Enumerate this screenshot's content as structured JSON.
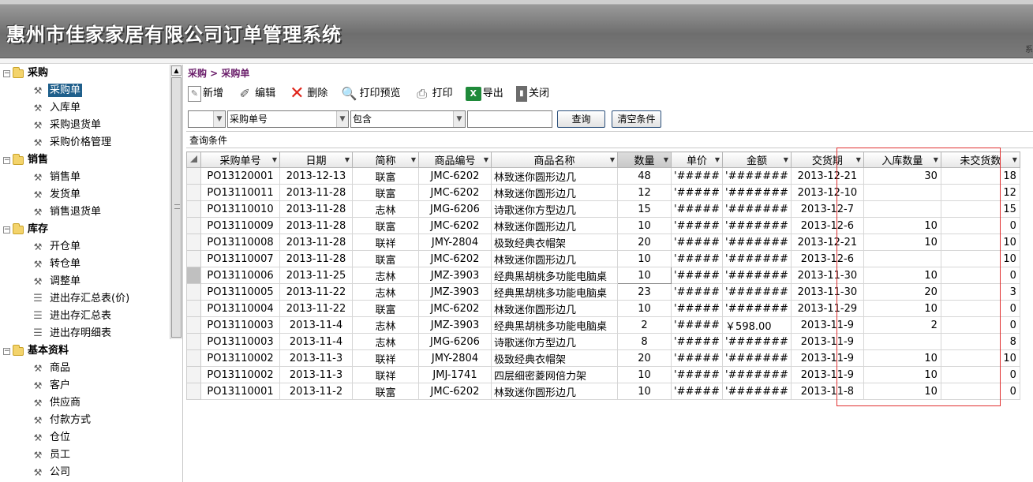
{
  "app": {
    "title": "惠州市佳家家居有限公司订单管理系统",
    "header_mark": "系"
  },
  "sidebar": {
    "groups": [
      {
        "label": "采购",
        "items": [
          "采购单",
          "入库单",
          "采购退货单",
          "采购价格管理"
        ]
      },
      {
        "label": "销售",
        "items": [
          "销售单",
          "发货单",
          "销售退货单"
        ]
      },
      {
        "label": "库存",
        "items": [
          "开仓单",
          "转仓单",
          "调整单",
          "进出存汇总表(价)",
          "进出存汇总表",
          "进出存明细表"
        ]
      },
      {
        "label": "基本资料",
        "items": [
          "商品",
          "客户",
          "供应商",
          "付款方式",
          "仓位",
          "员工",
          "公司"
        ]
      }
    ],
    "selected": "采购单"
  },
  "breadcrumb": "采购 > 采购单",
  "toolbar": {
    "new": "新增",
    "edit": "编辑",
    "delete": "删除",
    "print_preview": "打印预览",
    "print": "打印",
    "export": "导出",
    "close": "关闭"
  },
  "filter": {
    "field_value": "采购单号",
    "operator_value": "包含",
    "keyword_value": "",
    "query_button": "查询",
    "clear_button": "清空条件",
    "conditions_label": "查询条件"
  },
  "grid": {
    "columns": [
      "采购单号",
      "日期",
      "简称",
      "商品编号",
      "商品名称",
      "数量",
      "单价",
      "金额",
      "交货期",
      "入库数量",
      "未交货数"
    ],
    "sorted_column": "数量",
    "rows": [
      [
        "PO13120001",
        "2013-12-13",
        "联富",
        "JMC-6202",
        "林致迷你圆形边几",
        "48",
        "'#####",
        "'#######",
        "2013-12-21",
        "30",
        "18"
      ],
      [
        "PO13110011",
        "2013-11-28",
        "联富",
        "JMC-6202",
        "林致迷你圆形边几",
        "12",
        "'#####",
        "'#######",
        "2013-12-10",
        "",
        "12"
      ],
      [
        "PO13110010",
        "2013-11-28",
        "志林",
        "JMG-6206",
        "诗歌迷你方型边几",
        "15",
        "'#####",
        "'#######",
        "2013-12-7",
        "",
        "15"
      ],
      [
        "PO13110009",
        "2013-11-28",
        "联富",
        "JMC-6202",
        "林致迷你圆形边几",
        "10",
        "'#####",
        "'#######",
        "2013-12-6",
        "10",
        "0"
      ],
      [
        "PO13110008",
        "2013-11-28",
        "联祥",
        "JMY-2804",
        "极致经典衣帽架",
        "20",
        "'#####",
        "'#######",
        "2013-12-21",
        "10",
        "10"
      ],
      [
        "PO13110007",
        "2013-11-28",
        "联富",
        "JMC-6202",
        "林致迷你圆形边几",
        "10",
        "'#####",
        "'#######",
        "2013-12-6",
        "",
        "10"
      ],
      [
        "PO13110006",
        "2013-11-25",
        "志林",
        "JMZ-3903",
        "经典黑胡桃多功能电脑桌",
        "10",
        "'#####",
        "'#######",
        "2013-11-30",
        "10",
        "0"
      ],
      [
        "PO13110005",
        "2013-11-22",
        "志林",
        "JMZ-3903",
        "经典黑胡桃多功能电脑桌",
        "23",
        "'#####",
        "'#######",
        "2013-11-30",
        "20",
        "3"
      ],
      [
        "PO13110004",
        "2013-11-22",
        "联富",
        "JMC-6202",
        "林致迷你圆形边几",
        "10",
        "'#####",
        "'#######",
        "2013-11-29",
        "10",
        "0"
      ],
      [
        "PO13110003",
        "2013-11-4",
        "志林",
        "JMZ-3903",
        "经典黑胡桃多功能电脑桌",
        "2",
        "'#####",
        "￥598.00",
        "2013-11-9",
        "2",
        "0"
      ],
      [
        "PO13110003",
        "2013-11-4",
        "志林",
        "JMG-6206",
        "诗歌迷你方型边几",
        "8",
        "'#####",
        "'#######",
        "2013-11-9",
        "",
        "8"
      ],
      [
        "PO13110002",
        "2013-11-3",
        "联祥",
        "JMY-2804",
        "极致经典衣帽架",
        "20",
        "'#####",
        "'#######",
        "2013-11-9",
        "10",
        "10"
      ],
      [
        "PO13110002",
        "2013-11-3",
        "联祥",
        "JMJ-1741",
        "四层细密菱网倍力架",
        "10",
        "'#####",
        "'#######",
        "2013-11-9",
        "10",
        "0"
      ],
      [
        "PO13110001",
        "2013-11-2",
        "联富",
        "JMC-6202",
        "林致迷你圆形边几",
        "10",
        "'#####",
        "'#######",
        "2013-11-8",
        "10",
        "0"
      ]
    ],
    "current_row_index": 6
  }
}
